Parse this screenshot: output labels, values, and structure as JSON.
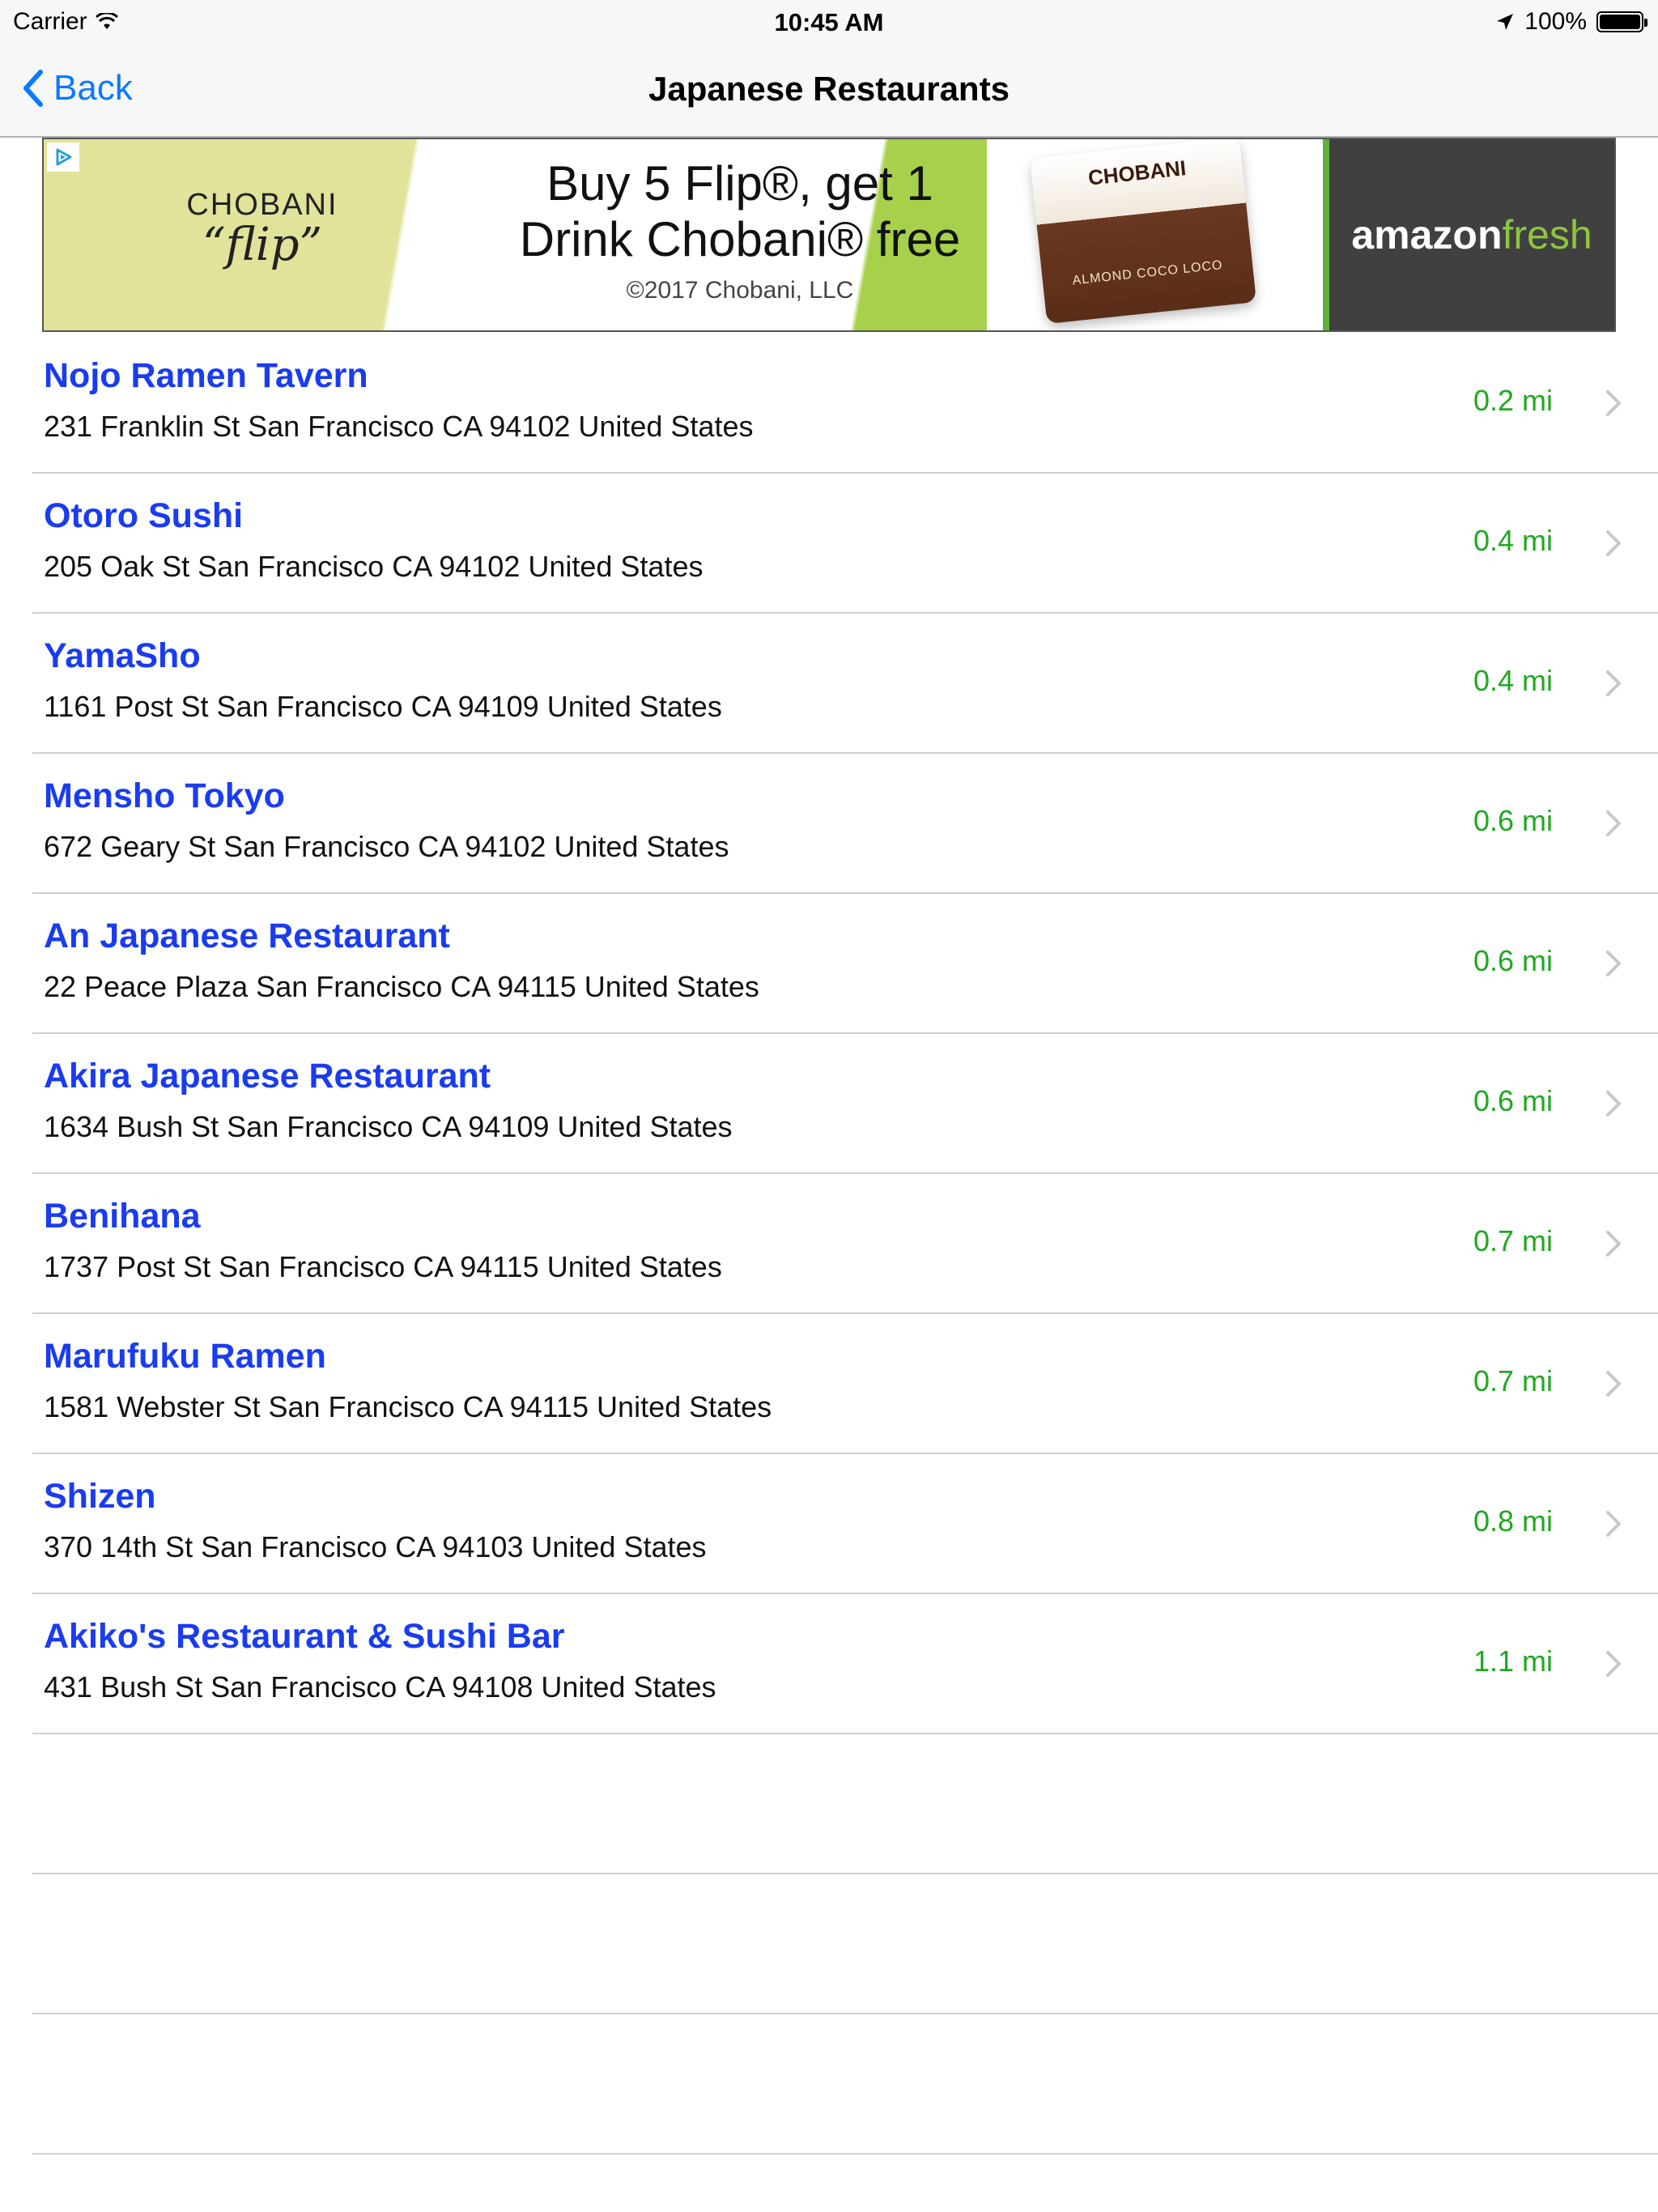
{
  "status_bar": {
    "carrier": "Carrier",
    "time": "10:45 AM",
    "battery": "100%",
    "battery_level": 1.0
  },
  "nav": {
    "back_label": "Back",
    "title": "Japanese Restaurants"
  },
  "ad": {
    "brand_line1": "CHOBANI",
    "brand_line2": "“flip”",
    "headline_line1": "Buy 5 Flip®, get 1",
    "headline_line2": "Drink Chobani® free",
    "copyright": "©2017 Chobani, LLC",
    "product_label": "CHOBANI",
    "product_sublabel": "ALMOND COCO LOCO",
    "partner_part1": "amazon",
    "partner_part2": "fresh"
  },
  "restaurants": [
    {
      "name": "Nojo Ramen Tavern",
      "address": "231 Franklin St San Francisco CA 94102 United States",
      "distance": "0.2 mi"
    },
    {
      "name": "Otoro Sushi",
      "address": "205 Oak St San Francisco CA 94102 United States",
      "distance": "0.4 mi"
    },
    {
      "name": "YamaSho",
      "address": "1161 Post St San Francisco CA 94109 United States",
      "distance": "0.4 mi"
    },
    {
      "name": "Mensho Tokyo",
      "address": "672 Geary St San Francisco CA 94102 United States",
      "distance": "0.6 mi"
    },
    {
      "name": "An Japanese Restaurant",
      "address": "22 Peace Plaza San Francisco CA 94115 United States",
      "distance": "0.6 mi"
    },
    {
      "name": "Akira Japanese Restaurant",
      "address": "1634 Bush St San Francisco CA 94109 United States",
      "distance": "0.6 mi"
    },
    {
      "name": "Benihana",
      "address": "1737 Post St San Francisco CA 94115 United States",
      "distance": "0.7 mi"
    },
    {
      "name": "Marufuku Ramen",
      "address": "1581 Webster St San Francisco CA 94115 United States",
      "distance": "0.7 mi"
    },
    {
      "name": "Shizen",
      "address": "370 14th St San Francisco CA 94103 United States",
      "distance": "0.8 mi"
    },
    {
      "name": "Akiko's Restaurant & Sushi Bar",
      "address": "431 Bush St San Francisco CA 94108 United States",
      "distance": "1.1 mi"
    }
  ],
  "colors": {
    "link_blue": "#1a3cf0",
    "distance_green": "#1fa81f",
    "ios_tint": "#0a7aff"
  }
}
